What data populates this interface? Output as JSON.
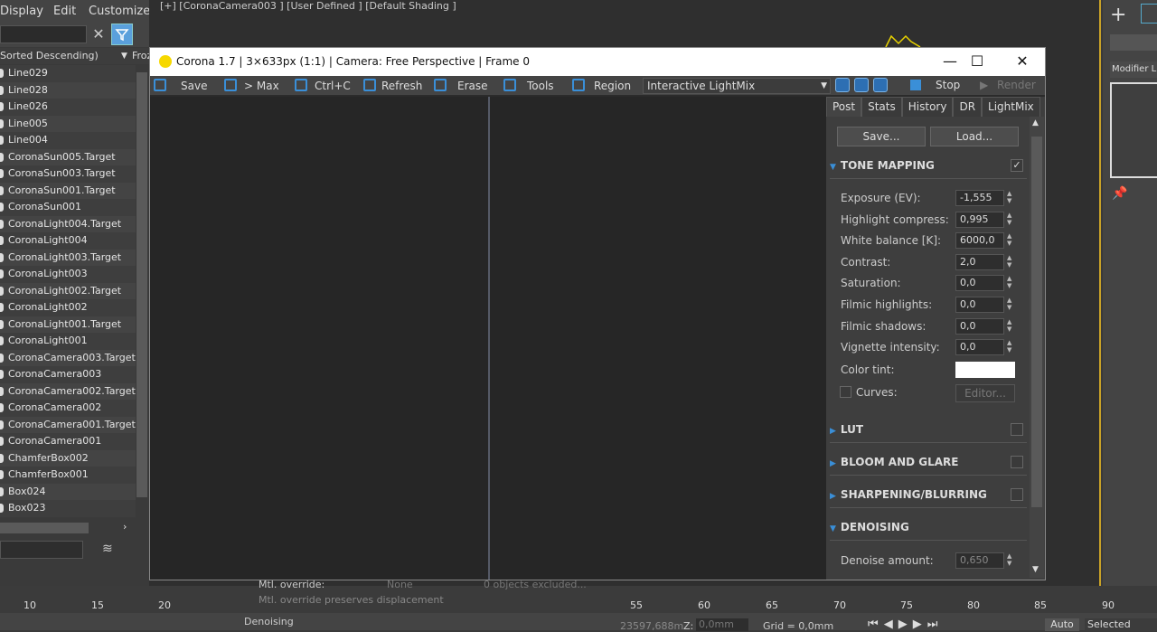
{
  "menu": {
    "display": "Display",
    "edit": "Edit",
    "customize": "Customize"
  },
  "viewport_label": "[+] [CoronaCamera003 ] [User Defined ] [Default Shading ]",
  "scene_explorer": {
    "sort_label": "Sorted Descending)",
    "frozen_label": "Froz",
    "items": [
      "Line029",
      "Line028",
      "Line026",
      "Line005",
      "Line004",
      "CoronaSun005.Target",
      "CoronaSun003.Target",
      "CoronaSun001.Target",
      "CoronaSun001",
      "CoronaLight004.Target",
      "CoronaLight004",
      "CoronaLight003.Target",
      "CoronaLight003",
      "CoronaLight002.Target",
      "CoronaLight002",
      "CoronaLight001.Target",
      "CoronaLight001",
      "CoronaCamera003.Target",
      "CoronaCamera003",
      "CoronaCamera002.Target",
      "CoronaCamera002",
      "CoronaCamera001.Target",
      "CoronaCamera001",
      "ChamferBox002",
      "ChamferBox001",
      "Box024",
      "Box023"
    ]
  },
  "right_panel": {
    "modifier_label": "Modifier Li"
  },
  "vfb": {
    "title": "Corona 1.7 | 3×633px (1:1) | Camera: Free Perspective | Frame 0",
    "toolbar": {
      "save": "Save",
      "max": "> Max",
      "ctrlc": "Ctrl+C",
      "refresh": "Refresh",
      "erase": "Erase",
      "tools": "Tools",
      "region": "Region",
      "mode": "Interactive LightMix",
      "stop": "Stop",
      "render": "Render"
    },
    "tabs": [
      "Post",
      "Stats",
      "History",
      "DR",
      "LightMix"
    ],
    "save_btn": "Save...",
    "load_btn": "Load...",
    "tone_mapping": {
      "title": "TONE MAPPING",
      "params": [
        {
          "label": "Exposure (EV):",
          "value": "-1,555"
        },
        {
          "label": "Highlight compress:",
          "value": "0,995"
        },
        {
          "label": "White balance [K]:",
          "value": "6000,0"
        },
        {
          "label": "Contrast:",
          "value": "2,0"
        },
        {
          "label": "Saturation:",
          "value": "0,0"
        },
        {
          "label": "Filmic highlights:",
          "value": "0,0"
        },
        {
          "label": "Filmic shadows:",
          "value": "0,0"
        },
        {
          "label": "Vignette intensity:",
          "value": "0,0"
        }
      ],
      "color_tint": "Color tint:",
      "curves": "Curves:",
      "editor": "Editor..."
    },
    "lut": "LUT",
    "bloom": "BLOOM AND GLARE",
    "sharpening": "SHARPENING/BLURRING",
    "denoising": {
      "title": "DENOISING",
      "amount_label": "Denoise amount:",
      "amount_value": "0,650"
    }
  },
  "bottom_panel": {
    "mtl_override": "Mtl. override:",
    "none": "None",
    "excluded": "0 objects excluded...",
    "preserves": "Mtl. override preserves displacement",
    "denoising": "Denoising"
  },
  "timeline": {
    "ticks": [
      "10",
      "15",
      "20",
      "55",
      "60",
      "65",
      "70",
      "75",
      "80",
      "85",
      "90"
    ]
  },
  "status": {
    "coord": "23597,688m",
    "z_label": "Z:",
    "z_value": "0,0mm",
    "grid": "Grid = 0,0mm",
    "auto": "Auto",
    "selected": "Selected"
  }
}
